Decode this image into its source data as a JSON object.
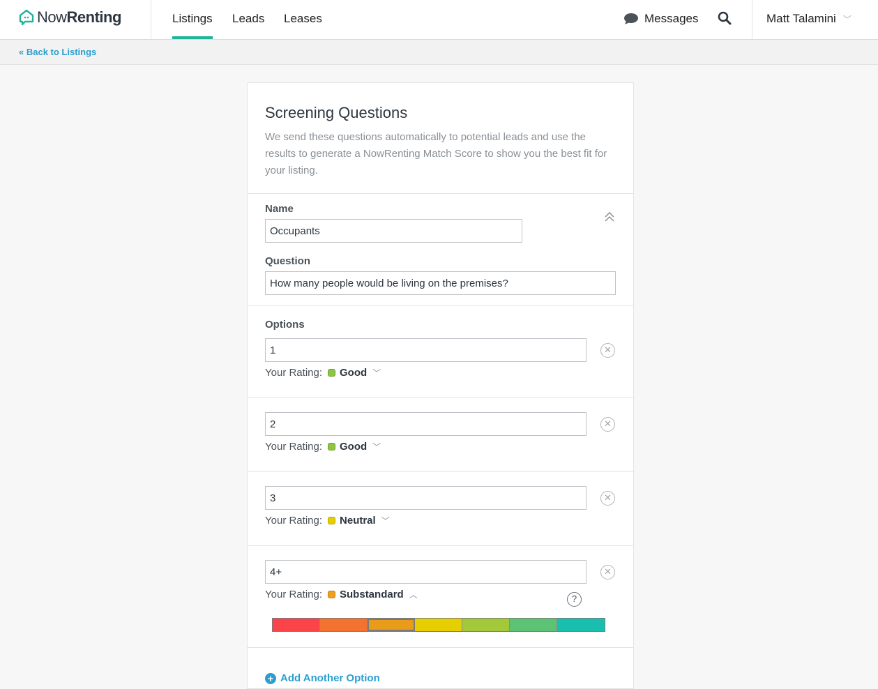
{
  "header": {
    "logo_prefix": "Now",
    "logo_suffix": "Renting",
    "nav": [
      "Listings",
      "Leads",
      "Leases"
    ],
    "active_nav": "Listings",
    "messages": "Messages",
    "user": "Matt Talamini"
  },
  "subnav": {
    "back": "« Back to Listings"
  },
  "card": {
    "title": "Screening Questions",
    "description": "We send these questions automatically to potential leads and use the results to generate a NowRenting Match Score to show you the best fit for your listing.",
    "name_label": "Name",
    "name_value": "Occupants",
    "question_label": "Question",
    "question_value": "How many people would be living on the premises?",
    "options_label": "Options",
    "rating_label": "Your Rating:",
    "options": [
      {
        "value": "1",
        "rating": "Good",
        "color": "#8dc63f"
      },
      {
        "value": "2",
        "rating": "Good",
        "color": "#8dc63f"
      },
      {
        "value": "3",
        "rating": "Neutral",
        "color": "#e6cf00"
      },
      {
        "value": "4+",
        "rating": "Substandard",
        "color": "#f0a020"
      }
    ],
    "scale_colors": [
      "#fb434a",
      "#f47230",
      "#e99b1a",
      "#e5cf00",
      "#a3c93a",
      "#5cc374",
      "#18bfae"
    ],
    "selected_scale_index": 2,
    "add_option": "Add Another Option"
  }
}
